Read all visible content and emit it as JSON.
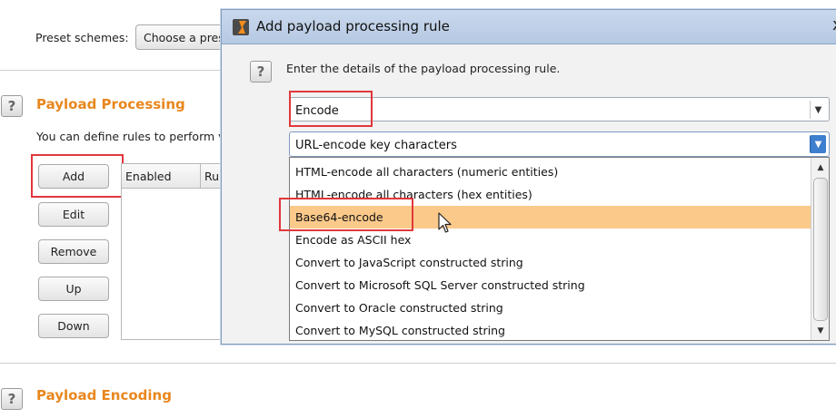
{
  "background": {
    "preset_label": "Preset schemes:",
    "preset_combo": "Choose a pres",
    "payload_processing": {
      "title": "Payload Processing",
      "description": "You can define rules to perform v",
      "buttons": {
        "add": "Add",
        "edit": "Edit",
        "remove": "Remove",
        "up": "Up",
        "down": "Down"
      },
      "columns": {
        "enabled": "Enabled",
        "rule": "Ru"
      }
    },
    "payload_encoding": {
      "title": "Payload Encoding"
    }
  },
  "dialog": {
    "title": "Add payload processing rule",
    "close": "x",
    "description": "Enter the details of the payload processing rule.",
    "rule_type": "Encode",
    "encoding_selected": "URL-encode key characters",
    "options": [
      "HTML-encode all characters (numeric entities)",
      "HTML-encode all characters (hex entities)",
      "Base64-encode",
      "Encode as ASCII hex",
      "Convert to JavaScript constructed string",
      "Convert to Microsoft SQL Server constructed string",
      "Convert to Oracle constructed string",
      "Convert to MySQL constructed string"
    ],
    "highlighted_option": "Base64-encode"
  },
  "icons": {
    "help": "?",
    "dropdown_arrow": "▼",
    "scroll_up": "▲",
    "scroll_down": "▼"
  },
  "colors": {
    "section_title": "#e8871e",
    "highlight": "#fbc98a",
    "annotation_red": "#e1373b",
    "titlebar": "#b6c9e3"
  }
}
